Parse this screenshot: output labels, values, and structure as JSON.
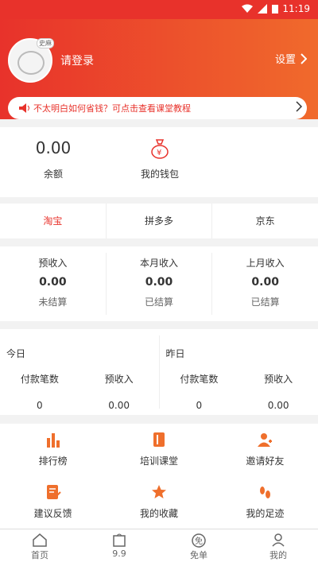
{
  "status_bar": {
    "time": "11:19"
  },
  "header": {
    "login_text": "请登录",
    "settings_label": "设置",
    "avatar_tag": "史麻"
  },
  "notice": {
    "text": "不太明白如何省钱？可点击查看课堂教程"
  },
  "wallet": {
    "balance_value": "0.00",
    "balance_label": "余额",
    "my_wallet_label": "我的钱包"
  },
  "platforms": {
    "tabs": [
      "淘宝",
      "拼多多",
      "京东"
    ],
    "active_index": 0
  },
  "income": [
    {
      "title": "预收入",
      "value": "0.00",
      "status": "未结算"
    },
    {
      "title": "本月收入",
      "value": "0.00",
      "status": "已结算"
    },
    {
      "title": "上月收入",
      "value": "0.00",
      "status": "已结算"
    }
  ],
  "daily": {
    "today": {
      "label": "今日",
      "col1": "付款笔数",
      "col2": "预收入",
      "val1": "0",
      "val2": "0.00"
    },
    "yesterday": {
      "label": "昨日",
      "col1": "付款笔数",
      "col2": "预收入",
      "val1": "0",
      "val2": "0.00"
    }
  },
  "menu": [
    {
      "label": "排行榜",
      "icon": "bar-chart-icon"
    },
    {
      "label": "培训课堂",
      "icon": "book-icon"
    },
    {
      "label": "邀请好友",
      "icon": "user-add-icon"
    },
    {
      "label": "建议反馈",
      "icon": "feedback-icon"
    },
    {
      "label": "我的收藏",
      "icon": "star-icon"
    },
    {
      "label": "我的足迹",
      "icon": "footprint-icon"
    }
  ],
  "tabbar": [
    {
      "label": "首页",
      "icon": "home-icon"
    },
    {
      "label": "9.9",
      "icon": "bag-icon"
    },
    {
      "label": "免单",
      "icon": "free-icon"
    },
    {
      "label": "我的",
      "icon": "user-icon"
    }
  ],
  "colors": {
    "accent": "#e8322b",
    "accent2": "#f06a2c"
  }
}
